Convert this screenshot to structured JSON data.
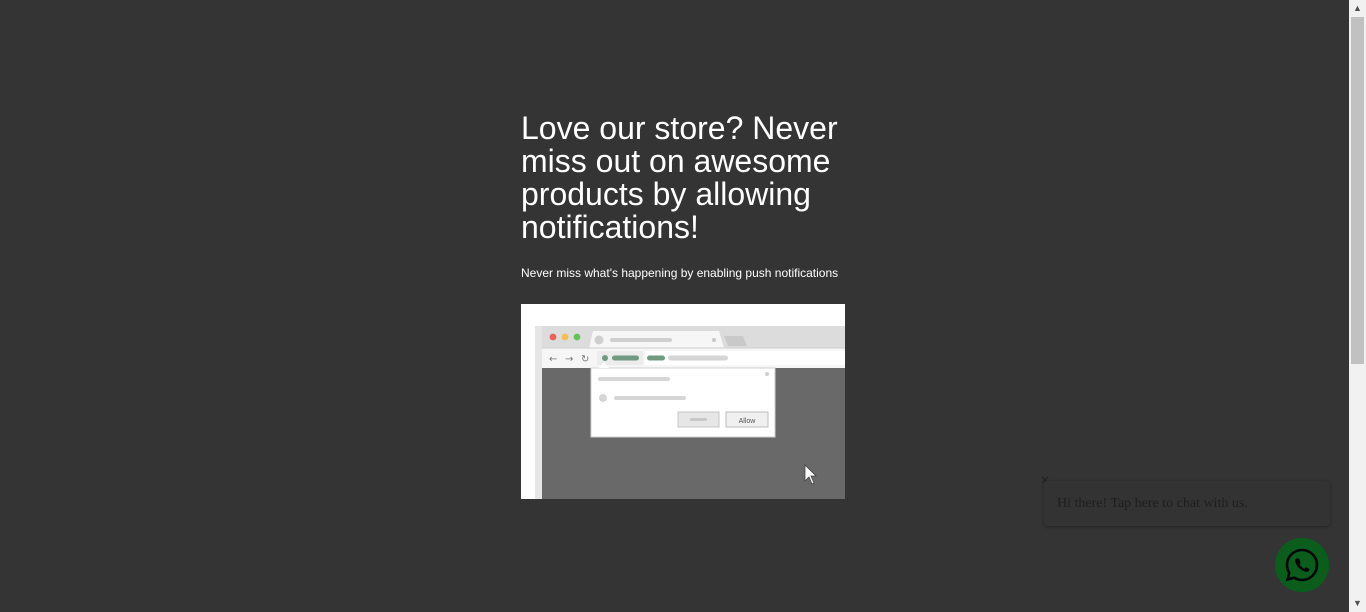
{
  "prompt": {
    "headline": "Love our store? Never miss out on awesome products by allowing notifications!",
    "subtext": "Never miss what's happening by enabling push notifications",
    "illustration": {
      "allow_label": "Allow"
    }
  },
  "chat": {
    "close_icon": "×",
    "greeting": "Hi there! Tap here to chat with us.",
    "button_icon": "whatsapp-icon"
  },
  "scrollbar": {
    "up_arrow": "▲",
    "down_arrow": "▼"
  },
  "colors": {
    "background": "#343434",
    "whatsapp_green": "#0a5d1b"
  }
}
